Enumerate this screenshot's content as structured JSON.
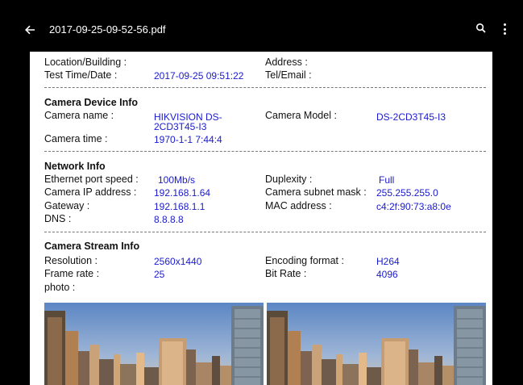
{
  "toolbar": {
    "title": "2017-09-25-09-52-56.pdf",
    "back_icon": "arrow-back-icon",
    "search_icon": "search-icon",
    "more_icon": "more-vert-icon"
  },
  "report": {
    "location_label": "Location/Building :",
    "address_label": "Address :",
    "test_time_label": "Test  Time/Date :",
    "test_time_value": "2017-09-25 09:51:22",
    "tel_label": "Tel/Email :",
    "camera_device": {
      "heading": "Camera Device Info",
      "name_label": "Camera name :",
      "name_value_line1": "HIKVISION DS-",
      "name_value_line2": "2CD3T45-I3",
      "model_label": "Camera Model :",
      "model_value": "DS-2CD3T45-I3",
      "time_label": "Camera time :",
      "time_value": "1970-1-1 7:44:4"
    },
    "network": {
      "heading": "Network Info",
      "port_speed_label": "Ethernet port speed :",
      "port_speed_value": "100Mb/s",
      "duplexity_label": "Duplexity :",
      "duplexity_value": "Full",
      "ip_label": "Camera IP address :",
      "ip_value": "192.168.1.64",
      "mask_label": "Camera subnet mask :",
      "mask_value": "255.255.255.0",
      "gateway_label": "Gateway :",
      "gateway_value": "192.168.1.1",
      "mac_label": "MAC address :",
      "mac_value": "c4:2f:90:73:a8:0e",
      "dns_label": "DNS :",
      "dns_value": "8.8.8.8"
    },
    "stream": {
      "heading": "Camera Stream Info",
      "resolution_label": "Resolution :",
      "resolution_value": "2560x1440",
      "encoding_label": "Encoding format :",
      "encoding_value": "H264",
      "frame_rate_label": "Frame rate :",
      "frame_rate_value": "25",
      "bit_rate_label": "Bit Rate :",
      "bit_rate_value": "4096",
      "photo_label": "photo :"
    }
  },
  "colors": {
    "value_text": "#1a1ad0",
    "page_bg": "#ffffff",
    "chrome_bg": "#000000"
  }
}
